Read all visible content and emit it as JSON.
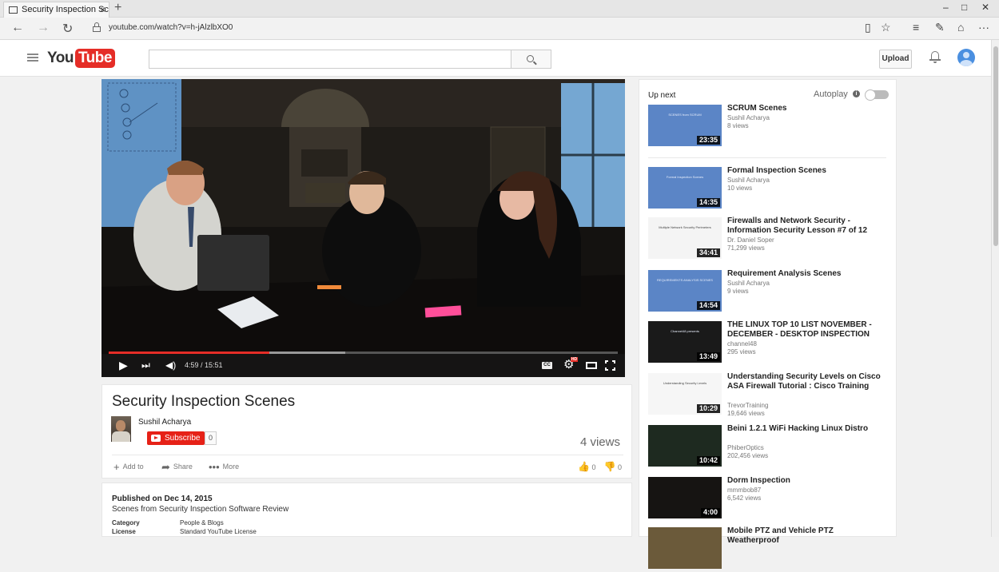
{
  "browser": {
    "tab_title": "Security Inspection Scer",
    "tab_close": "×",
    "new_tab": "+",
    "url": "youtube.com/watch?v=h-jAlzlbXO0",
    "win_minimize": "–",
    "win_maximize": "□",
    "win_close": "✕"
  },
  "header": {
    "logo_you": "You",
    "logo_tube": "Tube",
    "search_placeholder": "",
    "upload_label": "Upload"
  },
  "player": {
    "time": "4:59 / 15:51",
    "progress_played": 0.315,
    "progress_buffered": 0.465,
    "cc_label": "CC",
    "hd_label": "HD"
  },
  "video": {
    "title": "Security Inspection Scenes",
    "channel": "Sushil Acharya",
    "subscribe_label": "Subscribe",
    "subscriber_count": "0",
    "views": "4 views",
    "add_to": "Add to",
    "share": "Share",
    "more": "More",
    "likes": "0",
    "dislikes": "0"
  },
  "description": {
    "published": "Published on Dec 14, 2015",
    "text": "Scenes from Security Inspection Software Review",
    "category_label": "Category",
    "category_value": "People & Blogs",
    "license_label": "License",
    "license_value": "Standard YouTube License"
  },
  "sidebar": {
    "up_next_label": "Up next",
    "autoplay_label": "Autoplay",
    "videos": [
      {
        "title": "SCRUM Scenes",
        "channel": "Sushil Acharya",
        "views": "8 views",
        "duration": "23:35",
        "thumb_text": "SCENES from SCRUM",
        "thumb_color": "#5b85c6"
      },
      {
        "title": "Formal Inspection Scenes",
        "channel": "Sushil Acharya",
        "views": "10 views",
        "duration": "14:35",
        "thumb_text": "Formal Inspection Scenes",
        "thumb_color": "#5b85c6"
      },
      {
        "title": "Firewalls and Network Security - Information Security Lesson #7 of 12",
        "channel": "Dr. Daniel Soper",
        "views": "71,299 views",
        "duration": "34:41",
        "thumb_text": "Multiple Network Security Perimeters",
        "thumb_color": "#f4f4f4"
      },
      {
        "title": "Requirement Analysis Scenes",
        "channel": "Sushil Acharya",
        "views": "9 views",
        "duration": "14:54",
        "thumb_text": "REQUIREMENTS ANALYSIS SCENES",
        "thumb_color": "#5b85c6"
      },
      {
        "title": "THE LINUX TOP 10 LIST NOVEMBER - DECEMBER - DESKTOP INSPECTION",
        "channel": "channel48",
        "views": "295 views",
        "duration": "13:49",
        "thumb_text": "Channel48 presents",
        "thumb_color": "#1a1a1a"
      },
      {
        "title": "Understanding Security Levels on Cisco ASA Firewall Tutorial : Cisco Training",
        "channel": "TrevorTraining",
        "views": "19,646 views",
        "duration": "10:29",
        "thumb_text": "Understanding Security Levels",
        "thumb_color": "#f6f6f6"
      },
      {
        "title": "Beini 1.2.1 WiFi Hacking Linux Distro",
        "channel": "PhiberOptics",
        "views": "202,456 views",
        "duration": "10:42",
        "thumb_text": "",
        "thumb_color": "#1e2a20"
      },
      {
        "title": "Dorm Inspection",
        "channel": "mmmbob87",
        "views": "6,542 views",
        "duration": "4:00",
        "thumb_text": "",
        "thumb_color": "#161412"
      },
      {
        "title": "Mobile PTZ and Vehicle PTZ Weatherproof",
        "channel": "",
        "views": "",
        "duration": "",
        "thumb_text": "",
        "thumb_color": "#6b5a3a"
      }
    ]
  }
}
